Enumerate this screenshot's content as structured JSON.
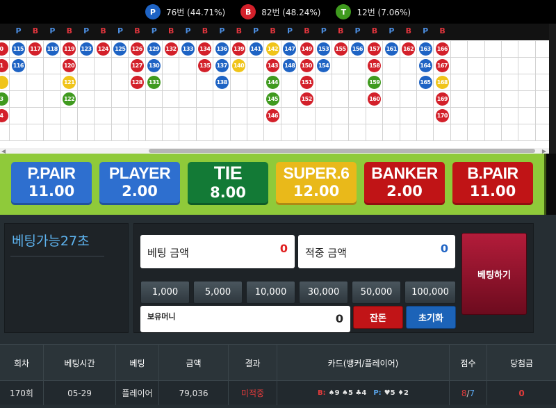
{
  "stats": [
    {
      "symbol": "P",
      "text": "76번 (44.71%)",
      "color": "#1e63c4"
    },
    {
      "symbol": "B",
      "text": "82번 (48.24%)",
      "color": "#d3202a"
    },
    {
      "symbol": "T",
      "text": "12번 (7.06%)",
      "color": "#3f9a1e"
    }
  ],
  "road": {
    "header_labels": [
      "P",
      "B",
      "P",
      "B",
      "P",
      "B",
      "P",
      "B",
      "P",
      "B",
      "P",
      "B",
      "P",
      "B",
      "P",
      "B",
      "P",
      "B",
      "P",
      "B",
      "P",
      "B",
      "P",
      "B",
      "P",
      "B"
    ],
    "columns": [
      {
        "x": 0,
        "cells": [
          {
            "n": "0",
            "c": "B"
          },
          {
            "n": "1",
            "c": "B"
          },
          {
            "n": "",
            "c": "T"
          },
          {
            "n": "3",
            "c": "G"
          },
          {
            "n": "4",
            "c": "B"
          }
        ]
      },
      {
        "x": 1,
        "cells": [
          {
            "n": "115",
            "c": "P"
          },
          {
            "n": "116",
            "c": "P"
          }
        ]
      },
      {
        "x": 2,
        "cells": [
          {
            "n": "117",
            "c": "B"
          }
        ]
      },
      {
        "x": 3,
        "cells": [
          {
            "n": "118",
            "c": "P"
          }
        ]
      },
      {
        "x": 4,
        "cells": [
          {
            "n": "119",
            "c": "B"
          },
          {
            "n": "120",
            "c": "B"
          },
          {
            "n": "121",
            "c": "T"
          },
          {
            "n": "122",
            "c": "G"
          }
        ]
      },
      {
        "x": 5,
        "cells": [
          {
            "n": "123",
            "c": "P"
          }
        ]
      },
      {
        "x": 6,
        "cells": [
          {
            "n": "124",
            "c": "B"
          }
        ]
      },
      {
        "x": 7,
        "cells": [
          {
            "n": "125",
            "c": "P"
          }
        ]
      },
      {
        "x": 8,
        "cells": [
          {
            "n": "126",
            "c": "B"
          },
          {
            "n": "127",
            "c": "B"
          },
          {
            "n": "128",
            "c": "B"
          }
        ]
      },
      {
        "x": 9,
        "cells": [
          {
            "n": "129",
            "c": "P"
          },
          {
            "n": "130",
            "c": "P"
          },
          {
            "n": "131",
            "c": "G"
          }
        ]
      },
      {
        "x": 10,
        "cells": [
          {
            "n": "132",
            "c": "B"
          }
        ]
      },
      {
        "x": 11,
        "cells": [
          {
            "n": "133",
            "c": "P"
          }
        ]
      },
      {
        "x": 12,
        "cells": [
          {
            "n": "134",
            "c": "B"
          },
          {
            "n": "135",
            "c": "B"
          }
        ]
      },
      {
        "x": 13,
        "cells": [
          {
            "n": "136",
            "c": "P"
          },
          {
            "n": "137",
            "c": "P"
          },
          {
            "n": "138",
            "c": "P"
          }
        ]
      },
      {
        "x": 14,
        "cells": [
          {
            "n": "139",
            "c": "B"
          },
          {
            "n": "140",
            "c": "T"
          }
        ]
      },
      {
        "x": 15,
        "cells": [
          {
            "n": "141",
            "c": "P"
          }
        ]
      },
      {
        "x": 16,
        "cells": [
          {
            "n": "142",
            "c": "T"
          },
          {
            "n": "143",
            "c": "B"
          },
          {
            "n": "144",
            "c": "G"
          },
          {
            "n": "145",
            "c": "G"
          },
          {
            "n": "146",
            "c": "B"
          }
        ]
      },
      {
        "x": 17,
        "cells": [
          {
            "n": "147",
            "c": "P"
          },
          {
            "n": "148",
            "c": "P"
          }
        ]
      },
      {
        "x": 18,
        "cells": [
          {
            "n": "149",
            "c": "B"
          },
          {
            "n": "150",
            "c": "B"
          },
          {
            "n": "151",
            "c": "B"
          },
          {
            "n": "152",
            "c": "B"
          }
        ]
      },
      {
        "x": 19,
        "cells": [
          {
            "n": "153",
            "c": "P"
          },
          {
            "n": "154",
            "c": "P"
          }
        ]
      },
      {
        "x": 20,
        "cells": [
          {
            "n": "155",
            "c": "B"
          }
        ]
      },
      {
        "x": 21,
        "cells": [
          {
            "n": "156",
            "c": "P"
          }
        ]
      },
      {
        "x": 22,
        "cells": [
          {
            "n": "157",
            "c": "B"
          },
          {
            "n": "158",
            "c": "B"
          },
          {
            "n": "159",
            "c": "G"
          },
          {
            "n": "160",
            "c": "B"
          }
        ]
      },
      {
        "x": 23,
        "cells": [
          {
            "n": "161",
            "c": "P"
          }
        ]
      },
      {
        "x": 24,
        "cells": [
          {
            "n": "162",
            "c": "B"
          }
        ]
      },
      {
        "x": 25,
        "cells": [
          {
            "n": "163",
            "c": "P"
          },
          {
            "n": "164",
            "c": "P"
          },
          {
            "n": "165",
            "c": "P"
          }
        ]
      },
      {
        "x": 26,
        "cells": [
          {
            "n": "166",
            "c": "B"
          },
          {
            "n": "167",
            "c": "B"
          },
          {
            "n": "168",
            "c": "T"
          },
          {
            "n": "169",
            "c": "B"
          },
          {
            "n": "170",
            "c": "B"
          }
        ]
      }
    ],
    "colors": {
      "P": "#1e63c4",
      "B": "#d3202a",
      "T": "#f0c419",
      "G": "#3f9a1e"
    }
  },
  "bets": [
    {
      "name": "P.PAIR",
      "odds": "11.00",
      "color": "#2e6fcf"
    },
    {
      "name": "PLAYER",
      "odds": "2.00",
      "color": "#2e6fcf"
    },
    {
      "name": "TIE",
      "odds": "8.00",
      "color": "#137a36"
    },
    {
      "name": "SUPER.6",
      "odds": "12.00",
      "color": "#e9b91a"
    },
    {
      "name": "BANKER",
      "odds": "2.00",
      "color": "#c01416"
    },
    {
      "name": "B.PAIR",
      "odds": "11.00",
      "color": "#c01416"
    }
  ],
  "timer": "베팅가능27초",
  "bet_amount": {
    "label": "베팅 금액",
    "value": "0"
  },
  "win_amount": {
    "label": "적중 금액",
    "value": "0"
  },
  "chips": [
    "1,000",
    "5,000",
    "10,000",
    "30,000",
    "50,000",
    "100,000"
  ],
  "balance": {
    "label": "보유머니",
    "value": "0"
  },
  "buttons": {
    "change": "잔돈",
    "reset": "초기화",
    "place": "베팅하기"
  },
  "table": {
    "headers": [
      "회차",
      "베팅시간",
      "베팅",
      "금액",
      "결과",
      "카드(뱅커/플레이어)",
      "점수",
      "당첨금"
    ],
    "rows": [
      {
        "round": "170회",
        "time": "05-29",
        "bet": "플레이어",
        "amount": "79,036",
        "result": "미적중",
        "banker_label": "B:",
        "banker_cards": "♠9 ♠5 ♣4",
        "player_label": "P:",
        "player_cards": "♥5 ♦2",
        "score_b": "8",
        "score_p": "7",
        "payout": "0"
      }
    ]
  }
}
